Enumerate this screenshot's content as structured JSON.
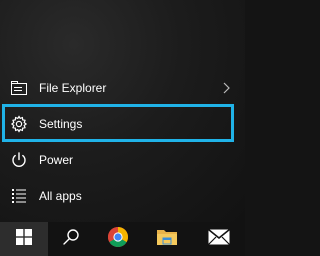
{
  "menu": {
    "file_explorer": {
      "label": "File Explorer",
      "icon": "folder-icon",
      "has_submenu": true
    },
    "settings": {
      "label": "Settings",
      "icon": "gear-icon",
      "highlighted": true
    },
    "power": {
      "label": "Power",
      "icon": "power-icon"
    },
    "all_apps": {
      "label": "All apps",
      "icon": "list-icon"
    }
  },
  "taskbar": {
    "buttons": [
      {
        "icon": "windows-logo-icon",
        "role": "start"
      },
      {
        "icon": "search-icon",
        "role": "search"
      },
      {
        "icon": "chrome-icon",
        "role": "app"
      },
      {
        "icon": "file-explorer-icon",
        "role": "app"
      },
      {
        "icon": "mail-icon",
        "role": "app"
      }
    ]
  },
  "colors": {
    "highlight": "#20b3e8",
    "text": "#ffffff",
    "taskbar": "#121212",
    "start_button": "#2d2d2d"
  }
}
